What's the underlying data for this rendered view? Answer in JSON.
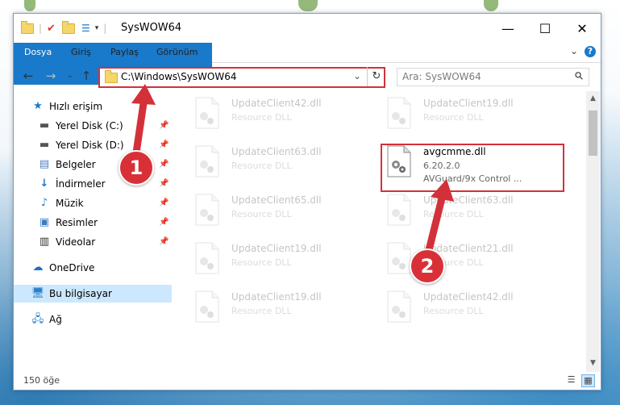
{
  "window": {
    "title": "SysWOW64",
    "minimize": "—",
    "maximize": "☐",
    "close": "✕"
  },
  "ribbon": {
    "tabs": [
      "Dosya",
      "Giriş",
      "Paylaş",
      "Görünüm"
    ],
    "help": "?"
  },
  "nav": {
    "address": "C:\\Windows\\SysWOW64",
    "search_placeholder": "Ara: SysWOW64"
  },
  "sidebar": {
    "items": [
      {
        "label": "Hızlı erişim",
        "icon": "star-icon",
        "pinned": false
      },
      {
        "label": "Yerel Disk (C:)",
        "icon": "drive-icon",
        "pinned": true
      },
      {
        "label": "Yerel Disk (D:)",
        "icon": "drive-icon",
        "pinned": true
      },
      {
        "label": "Belgeler",
        "icon": "documents-icon",
        "pinned": true
      },
      {
        "label": "İndirmeler",
        "icon": "download-icon",
        "pinned": true
      },
      {
        "label": "Müzik",
        "icon": "music-icon",
        "pinned": true
      },
      {
        "label": "Resimler",
        "icon": "pictures-icon",
        "pinned": true
      },
      {
        "label": "Videolar",
        "icon": "videos-icon",
        "pinned": true
      },
      {
        "label": "OneDrive",
        "icon": "cloud-icon",
        "pinned": false
      },
      {
        "label": "Bu bilgisayar",
        "icon": "computer-icon",
        "pinned": false,
        "selected": true
      },
      {
        "label": "Ağ",
        "icon": "network-icon",
        "pinned": false
      }
    ]
  },
  "files": {
    "left_column": [
      {
        "name": "UpdateClient42.dll",
        "type": "Resource DLL"
      },
      {
        "name": "UpdateClient63.dll",
        "type": "Resource DLL"
      },
      {
        "name": "UpdateClient65.dll",
        "type": "Resource DLL"
      },
      {
        "name": "UpdateClient19.dll",
        "type": "Resource DLL"
      },
      {
        "name": "UpdateClient19.dll",
        "type": "Resource DLL"
      }
    ],
    "right_column": [
      {
        "name": "UpdateClient19.dll",
        "type": "Resource DLL"
      },
      {
        "name": "avgcmme.dll",
        "version": "6.20.2.0",
        "type": "AVGuard/9x Control ...",
        "highlighted": true
      },
      {
        "name": "UpdateClient63.dll",
        "type": "Resource DLL"
      },
      {
        "name": "UpdateClient21.dll",
        "type": "Resource DLL"
      },
      {
        "name": "UpdateClient42.dll",
        "type": "Resource DLL"
      }
    ]
  },
  "annotations": {
    "callout_1": "1",
    "callout_2": "2",
    "color": "#d3313a"
  },
  "status": {
    "item_count": "150 öğe"
  }
}
